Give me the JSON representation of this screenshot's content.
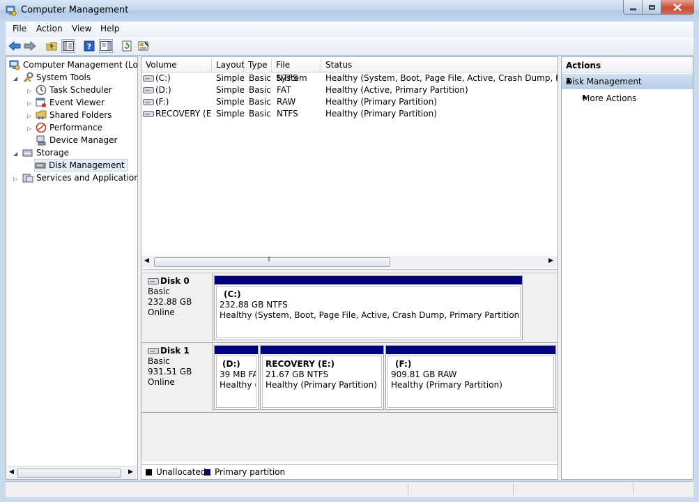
{
  "window": {
    "title": "Computer Management"
  },
  "menubar": {
    "items": [
      "File",
      "Action",
      "View",
      "Help"
    ]
  },
  "toolbar": {
    "buttons": [
      "back-icon",
      "forward-icon",
      "up-folder-icon",
      "show-hide-tree-icon",
      "help-icon",
      "show-hide-action-pane-icon",
      "refresh-icon",
      "properties-icon"
    ]
  },
  "tree": {
    "root": "Computer Management (Local",
    "system_tools": "System Tools",
    "task_scheduler": "Task Scheduler",
    "event_viewer": "Event Viewer",
    "shared_folders": "Shared Folders",
    "performance": "Performance",
    "device_manager": "Device Manager",
    "storage": "Storage",
    "disk_management": "Disk Management",
    "services": "Services and Applications"
  },
  "volume_list": {
    "columns": [
      "Volume",
      "Layout",
      "Type",
      "File System",
      "Status"
    ],
    "rows": [
      {
        "volume": "(C:)",
        "layout": "Simple",
        "type": "Basic",
        "fs": "NTFS",
        "status": "Healthy (System, Boot, Page File, Active, Crash Dump, Primary"
      },
      {
        "volume": "(D:)",
        "layout": "Simple",
        "type": "Basic",
        "fs": "FAT",
        "status": "Healthy (Active, Primary Partition)"
      },
      {
        "volume": "(F:)",
        "layout": "Simple",
        "type": "Basic",
        "fs": "RAW",
        "status": "Healthy (Primary Partition)"
      },
      {
        "volume": "RECOVERY (E:)",
        "layout": "Simple",
        "type": "Basic",
        "fs": "NTFS",
        "status": "Healthy (Primary Partition)"
      }
    ]
  },
  "disks": [
    {
      "name": "Disk 0",
      "type": "Basic",
      "size": "232.88 GB",
      "state": "Online",
      "partitions": [
        {
          "label": "(C:)",
          "size": "232.88 GB NTFS",
          "status": "Healthy (System, Boot, Page File, Active, Crash Dump, Primary Partition)"
        }
      ]
    },
    {
      "name": "Disk 1",
      "type": "Basic",
      "size": "931.51 GB",
      "state": "Online",
      "partitions": [
        {
          "label": "(D:)",
          "size": "39 MB FA",
          "status": "Healthy (A"
        },
        {
          "label": "RECOVERY  (E:)",
          "size": "21.67 GB NTFS",
          "status": "Healthy (Primary Partition)"
        },
        {
          "label": "(F:)",
          "size": "909.81 GB RAW",
          "status": "Healthy (Primary Partition)"
        }
      ]
    }
  ],
  "legend": {
    "unallocated": "Unallocated",
    "primary": "Primary partition",
    "unallocated_color": "#000000",
    "primary_color": "#00007f"
  },
  "actions": {
    "title": "Actions",
    "section": "Disk Management",
    "more": "More Actions"
  }
}
